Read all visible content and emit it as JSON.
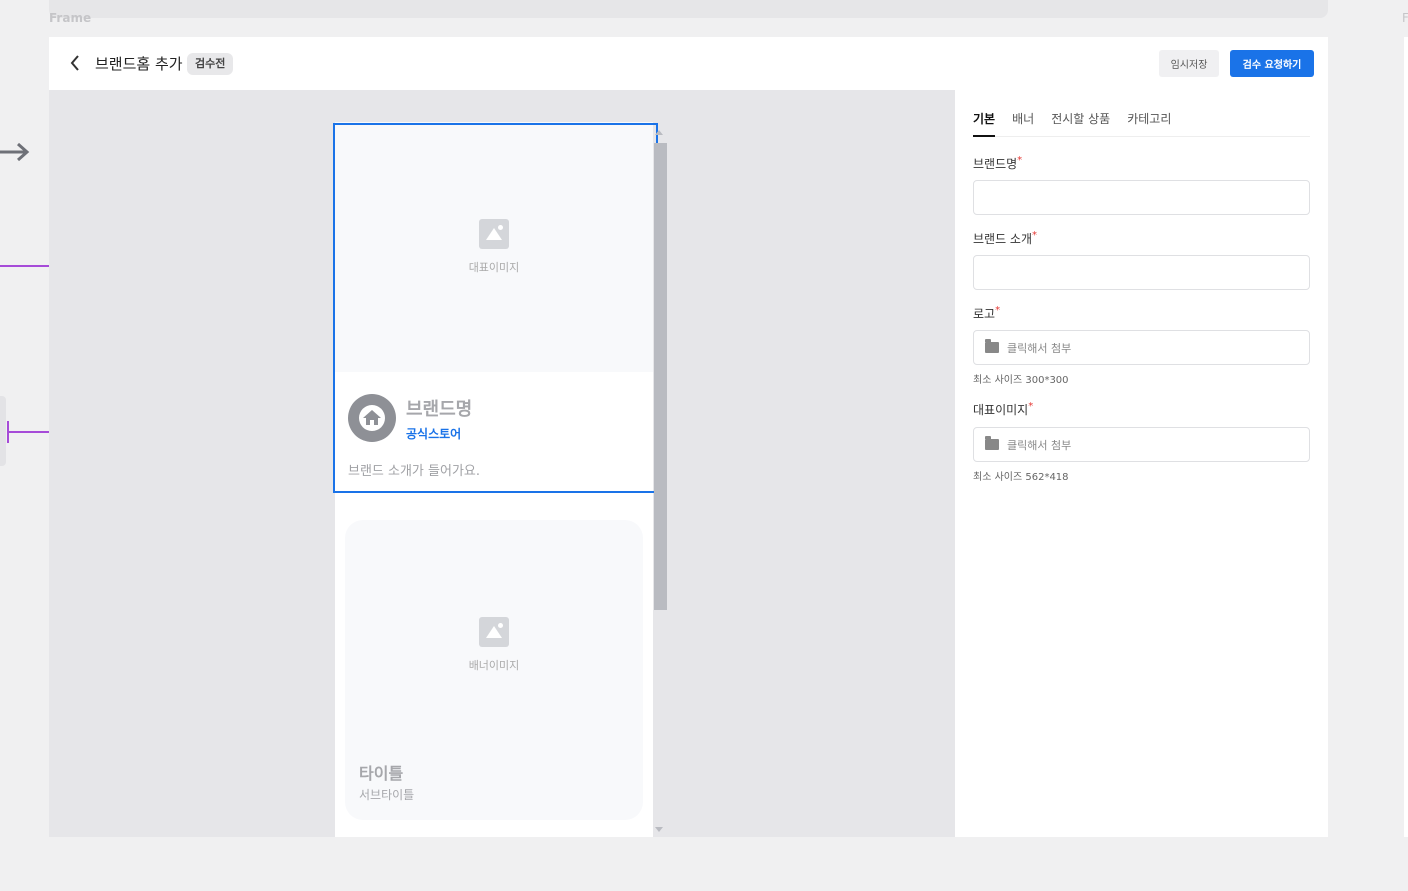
{
  "canvas": {
    "frame_label": "Frame",
    "frame_label_right": "F"
  },
  "header": {
    "title": "브랜드홈 추가",
    "status_badge": "검수전",
    "save_label": "임시저장",
    "submit_label": "검수 요청하기"
  },
  "preview": {
    "rep_image_caption": "대표이미지",
    "brand_name": "브랜드명",
    "official_label": "공식스토어",
    "brand_description": "브랜드 소개가 들어가요.",
    "banner_caption": "배너이미지",
    "banner_title": "타이틀",
    "banner_subtitle": "서브타이틀"
  },
  "panel": {
    "tabs": [
      "기본",
      "배너",
      "전시할 상품",
      "카테고리"
    ],
    "active_tab": "기본",
    "fields": {
      "brand_name_label": "브랜드명",
      "brand_intro_label": "브랜드 소개",
      "logo_label": "로고",
      "logo_placeholder": "클릭해서 첨부",
      "logo_help": "최소 사이즈 300*300",
      "rep_image_label": "대표이미지",
      "rep_image_placeholder": "클릭해서 첨부",
      "rep_image_help": "최소 사이즈 562*418",
      "required_mark": "*"
    }
  },
  "colors": {
    "accent": "#1a73e8",
    "connector": "#a64bd8",
    "required": "#e53935"
  }
}
